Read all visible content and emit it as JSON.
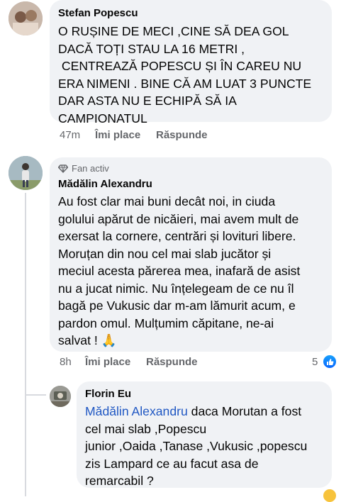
{
  "comments": [
    {
      "author": "Stefan Popescu",
      "lines": [
        "O RUȘINE DE MECI ,CINE SĂ DEA GOL",
        "DACĂ TOȚI STAU LA 16 METRI ,",
        " CENTREAZĂ POPESCU ȘI ÎN CAREU NU",
        "ERA NIMENI . BINE CĂ AM LUAT 3 PUNCTE",
        "DAR ASTA NU E ECHIPĂ SĂ IA",
        "CAMPIONATUL"
      ],
      "time": "47m",
      "like": "Îmi place",
      "reply": "Răspunde"
    },
    {
      "badge": "Fan activ",
      "author": "Mădălin Alexandru",
      "lines": [
        "Au fost clar mai buni decât noi, in ciuda",
        "golului apărut de nicăieri, mai avem mult de",
        "exersat la cornere, centrări și lovituri libere.",
        "Moruțan din nou cel mai slab jucător și",
        "meciul acesta părerea mea, inafară de asist",
        "nu a jucat nimic. Nu înțelegeam de ce nu îl",
        "bagă pe Vukusic dar m-am lămurit acum, e",
        "pardon omul. Mulțumim căpitane, ne-ai",
        "salvat ! 🙏"
      ],
      "time": "8h",
      "like": "Îmi place",
      "reply": "Răspunde",
      "reaction_count": "5"
    },
    {
      "author": "Florin Eu",
      "mention": "Mădălin Alexandru",
      "first_line_rest": " daca Morutan a fost",
      "lines": [
        "cel mai slab ,Popescu",
        "junior ,Oaida ,Tanase ,Vukusic ,popescu",
        "zis Lampard ce au facut asa de",
        "remarcabil ?"
      ]
    }
  ]
}
